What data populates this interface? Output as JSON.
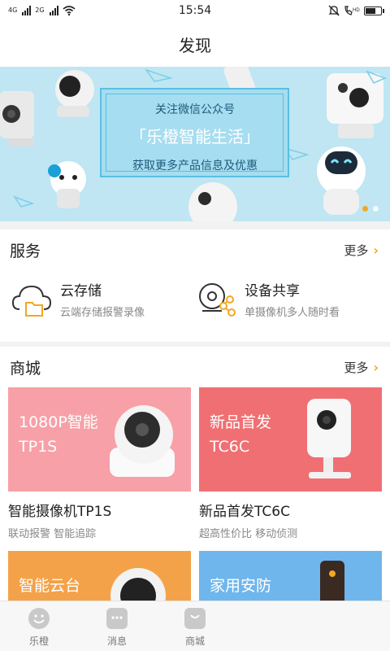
{
  "status_bar": {
    "network_left": "4G",
    "network_right": "2G",
    "time": "15:54",
    "hd": "HD"
  },
  "header": {
    "title": "发现"
  },
  "banner": {
    "line1": "关注微信公众号",
    "line2": "「乐橙智能生活」",
    "line3": "获取更多产品信息及优惠",
    "page_count": 2,
    "active_page": 1
  },
  "services": {
    "title": "服务",
    "more": "更多",
    "items": [
      {
        "name": "云存储",
        "desc": "云端存储报警录像",
        "icon": "cloud-folder-icon"
      },
      {
        "name": "设备共享",
        "desc": "单摄像机多人随时看",
        "icon": "camera-share-icon"
      }
    ]
  },
  "mall": {
    "title": "商城",
    "more": "更多",
    "cards": [
      {
        "tag_line1": "1080P智能",
        "tag_line2": "TP1S",
        "title": "智能摄像机TP1S",
        "sub": "联动报警  智能追踪",
        "color": "#f7a0a7"
      },
      {
        "tag_line1": "新品首发",
        "tag_line2": "TC6C",
        "title": "新品首发TC6C",
        "sub": "超高性价比  移动侦测",
        "color": "#f06f73"
      },
      {
        "tag_line1": "智能云台",
        "tag_line2": "",
        "title": "",
        "sub": "",
        "color": "#f4a24a"
      },
      {
        "tag_line1": "家用安防",
        "tag_line2": "",
        "title": "",
        "sub": "",
        "color": "#6fb6ec"
      }
    ]
  },
  "tabbar": {
    "tabs": [
      {
        "label": "乐橙",
        "icon": "smile-icon"
      },
      {
        "label": "消息",
        "icon": "message-icon"
      },
      {
        "label": "商城",
        "icon": "shopping-bag-icon"
      }
    ]
  },
  "colors": {
    "accent": "#f5a623",
    "banner_bg": "#bfe6f2",
    "banner_frame": "#5bbfe2"
  }
}
